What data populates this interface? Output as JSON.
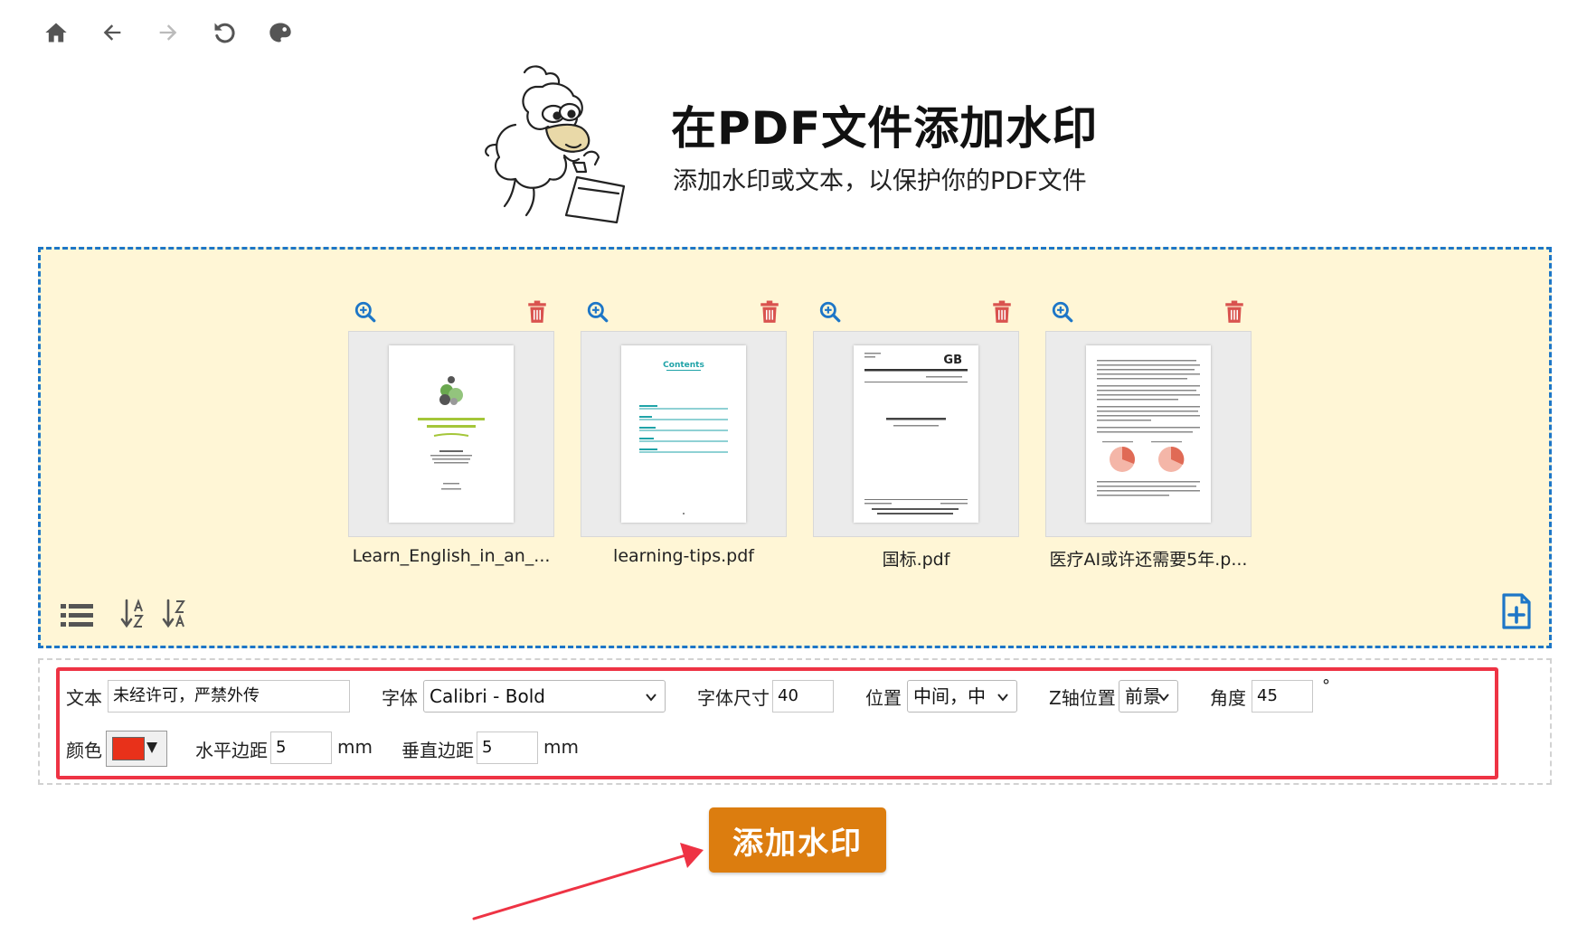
{
  "nav": {
    "icons": [
      "home-icon",
      "back-arrow-icon",
      "forward-arrow-icon",
      "reload-icon",
      "palette-icon"
    ]
  },
  "header": {
    "title": "在PDF文件添加水印",
    "subtitle": "添加水印或文本，以保护你的PDF文件"
  },
  "files": [
    {
      "name": "Learn_English_in_an_...",
      "thumb_icon": "pdf-page-thumbnail"
    },
    {
      "name": "learning-tips.pdf",
      "thumb_icon": "pdf-page-thumbnail"
    },
    {
      "name": "国标.pdf",
      "thumb_icon": "pdf-page-thumbnail"
    },
    {
      "name": "医疗AI或许还需要5年.p...",
      "thumb_icon": "pdf-page-thumbnail"
    }
  ],
  "thumbs": {
    "contents": "Contents",
    "gb": "GB"
  },
  "options": {
    "text_label": "文本",
    "text_value": "未经许可，严禁外传",
    "font_label": "字体",
    "font_value": "Calibri - Bold",
    "size_label": "字体尺寸",
    "size_value": "40",
    "position_label": "位置",
    "position_value": "中间，中",
    "z_label": "Z轴位置",
    "z_value": "前景",
    "angle_label": "角度",
    "angle_value": "45",
    "angle_unit": "°",
    "color_label": "颜色",
    "color_value": "#e8311a",
    "hmargin_label": "水平边距",
    "hmargin_value": "5",
    "hmargin_unit": "mm",
    "vmargin_label": "垂直边距",
    "vmargin_value": "5",
    "vmargin_unit": "mm"
  },
  "submit_label": "添加水印",
  "colors": {
    "accent_blue": "#1d76c7",
    "dropzone_bg": "#fff6d6",
    "highlight_red": "#ee3344",
    "submit_orange": "#dc7d0f",
    "delete_red": "#d9534f"
  }
}
